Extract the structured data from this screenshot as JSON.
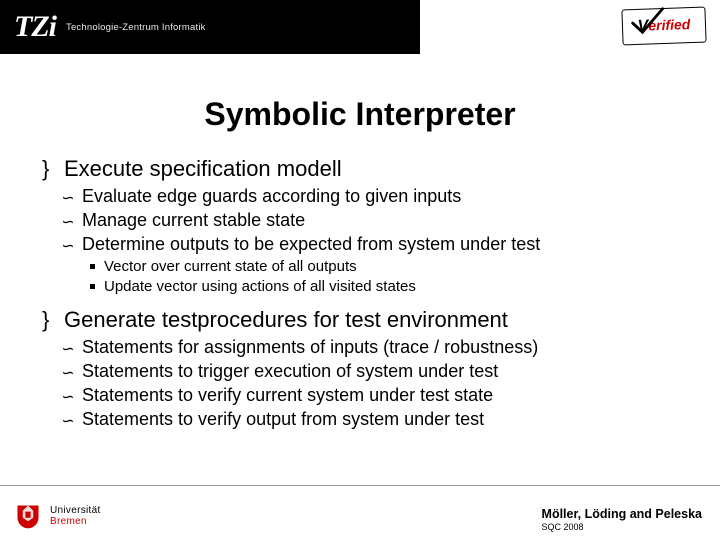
{
  "header": {
    "tzi_main": "TZi",
    "tzi_sub": "Technologie-Zentrum Informatik",
    "verified_v": "V",
    "verified_rest": "erified"
  },
  "title": "Symbolic Interpreter",
  "sections": [
    {
      "heading": "Execute specification modell",
      "items": [
        {
          "text": "Evaluate edge guards according to given inputs"
        },
        {
          "text": "Manage current stable state"
        },
        {
          "text": "Determine outputs to be expected from system under test",
          "sub": [
            "Vector over current state of all outputs",
            "Update vector using actions of all visited states"
          ]
        }
      ]
    },
    {
      "heading": "Generate testprocedures for test environment",
      "items": [
        {
          "text": "Statements for assignments of inputs (trace / robustness)"
        },
        {
          "text": "Statements to trigger execution of system under test"
        },
        {
          "text": "Statements to verify current system under test state"
        },
        {
          "text": "Statements to verify output from system under test"
        }
      ]
    }
  ],
  "footer": {
    "uni1": "Universität",
    "uni2": "Bremen",
    "authors": "Möller, Löding and Peleska",
    "conf": "SQC 2008"
  }
}
